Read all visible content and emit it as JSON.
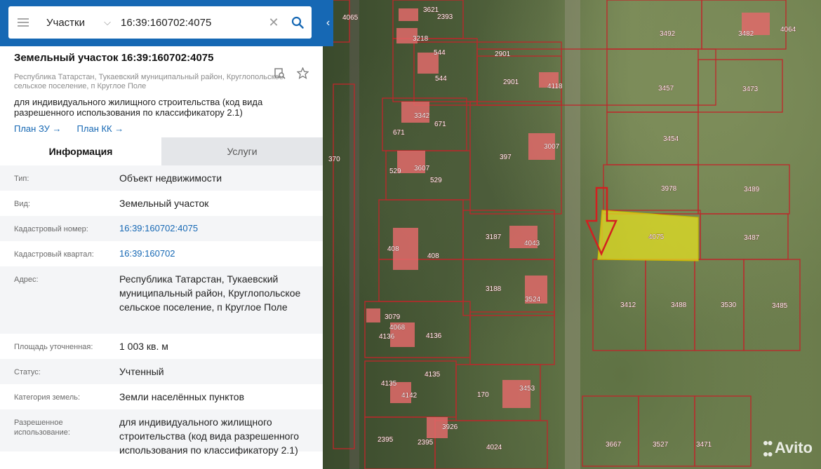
{
  "search": {
    "layer": "Участки",
    "query": "16:39:160702:4075"
  },
  "plot": {
    "title": "Земельный участок 16:39:160702:4075",
    "address_short": "Республика Татарстан, Тукаевский муниципальный район, Круглопольское сельское поселение, п Круглое Поле",
    "usage": "для индивидуального жилищного строительства (код вида разрешенного использования по классификатору 2.1)",
    "plan_zu": "План ЗУ →",
    "plan_kk": "План КК →"
  },
  "tabs": {
    "info": "Информация",
    "services": "Услуги"
  },
  "info_rows": [
    {
      "key": "Тип:",
      "value": "Объект недвижимости"
    },
    {
      "key": "Вид:",
      "value": "Земельный участок"
    },
    {
      "key": "Кадастровый номер:",
      "value": "16:39:160702:4075"
    },
    {
      "key": "Кадастровый квартал:",
      "value": "16:39:160702"
    },
    {
      "key": "Адрес:",
      "value": "Республика Татарстан, Тукаевский муниципальный район, Круглопольское сельское поселение, п Круглое Поле"
    },
    {
      "key": "Площадь уточненная:",
      "value": "1 003 кв. м"
    },
    {
      "key": "Статус:",
      "value": "Учтенный"
    },
    {
      "key": "Категория земель:",
      "value": "Земли населённых пунктов"
    },
    {
      "key": "Разрешенное использование:",
      "value": "для индивидуального жилищного строительства (код вида разрешенного использования по классификатору 2.1)"
    }
  ],
  "map": {
    "selected_plot": "4075",
    "plot_labels": [
      "4065",
      "3621",
      "2393",
      "3218",
      "544",
      "2901",
      "544",
      "2901",
      "4118",
      "3342",
      "671",
      "671",
      "3007",
      "397",
      "529",
      "3607",
      "529",
      "370",
      "3187",
      "4043",
      "408",
      "408",
      "3188",
      "3524",
      "4136",
      "3079",
      "4068",
      "4136",
      "4135",
      "4135",
      "4142",
      "170",
      "3453",
      "2395",
      "2395",
      "3926",
      "4024",
      "3492",
      "3482",
      "4064",
      "3457",
      "3473",
      "3454",
      "3978",
      "3489",
      "4075",
      "3487",
      "3412",
      "3488",
      "3530",
      "3485",
      "3667",
      "3527",
      "3471"
    ],
    "watermark": "Avito",
    "colors": {
      "boundary": "#c0262b",
      "selected_fill": "#e8e320",
      "arrow": "#d32020"
    }
  },
  "colors": {
    "header_blue": "#1668b4",
    "link_blue": "#1668b4"
  }
}
